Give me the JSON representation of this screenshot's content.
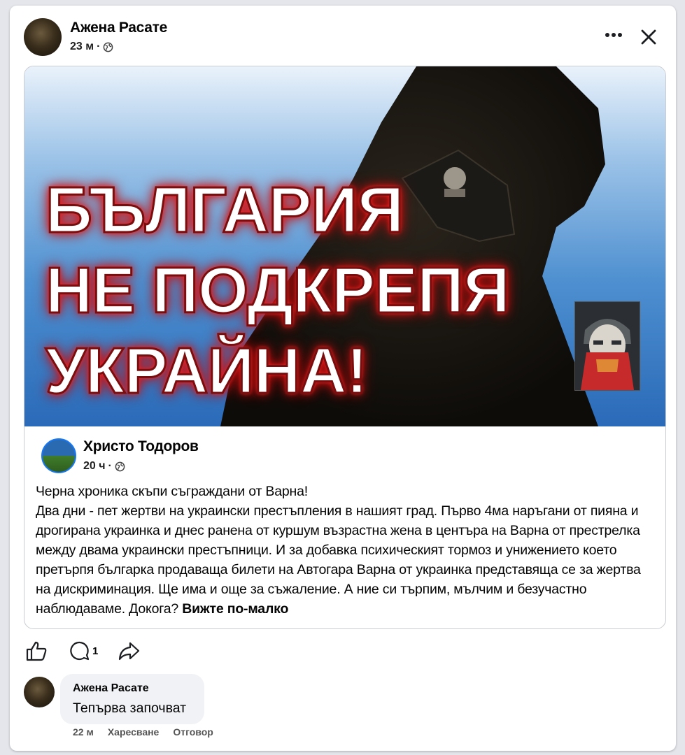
{
  "post": {
    "author": "Ажена Расате",
    "time": "23 м",
    "more_icon": "more-horizontal-icon",
    "close_icon": "close-icon"
  },
  "shared_post": {
    "image_text_lines": [
      "БЪЛГАРИЯ",
      "НЕ ПОДКРЕПЯ",
      "УКРАЙНА!"
    ],
    "author": "Христо Тодоров",
    "time": "20 ч",
    "text_title": "Черна хроника скъпи съграждани от Варна!",
    "text_body": "Два дни - пет жертви на украински престъпления в нашият град. Първо 4ма наръгани от пияна и дрогирана украинка и днес ранена от куршум възрастна жена в центъра на Варна от престрелка между двама украински престъпници. И за добавка  психическият тормоз и унижението което претърпя българка продаваща билети на Автогара Варна от украинка представяща се за жертва на дискриминация. Ще има и още за съжаление. А ние си търпим, мълчим и безучастно наблюдаваме. Докога?",
    "see_less": "Вижте по-малко"
  },
  "actions": {
    "comment_count": "1"
  },
  "comment": {
    "author": "Ажена Расате",
    "text": "Тепърва започват",
    "time": "22 м",
    "like_label": "Харесване",
    "reply_label": "Отговор"
  },
  "colors": {
    "accent": "#1877f2",
    "text": "#050505",
    "bubble": "#f0f2f5",
    "glow": "#e01818"
  }
}
